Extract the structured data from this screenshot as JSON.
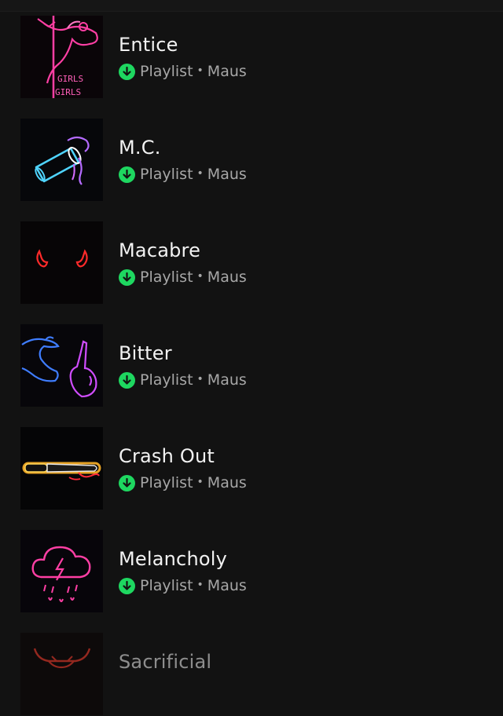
{
  "colors": {
    "background": "#121212",
    "title": "#f2f2f2",
    "subtitle": "#a7a7a7",
    "download_green": "#1ed760"
  },
  "playlists": [
    {
      "title": "Entice",
      "type": "Playlist",
      "owner": "Maus",
      "cover_icon": "neon-pole-dancer-girls-sign",
      "downloaded": true
    },
    {
      "title": "M.C.",
      "type": "Playlist",
      "owner": "Maus",
      "cover_icon": "neon-spilled-cup",
      "downloaded": true
    },
    {
      "title": "Macabre",
      "type": "Playlist",
      "owner": "Maus",
      "cover_icon": "neon-devil-horns",
      "downloaded": true
    },
    {
      "title": "Bitter",
      "type": "Playlist",
      "owner": "Maus",
      "cover_icon": "neon-hands",
      "downloaded": true
    },
    {
      "title": "Crash Out",
      "type": "Playlist",
      "owner": "Maus",
      "cover_icon": "neon-knife",
      "downloaded": true
    },
    {
      "title": "Melancholy",
      "type": "Playlist",
      "owner": "Maus",
      "cover_icon": "neon-storm-cloud",
      "downloaded": true
    },
    {
      "title": "Sacrificial",
      "cover_icon": "neon-bull-skull"
    }
  ],
  "cover_text": {
    "girls_sign": "GIRLS"
  }
}
